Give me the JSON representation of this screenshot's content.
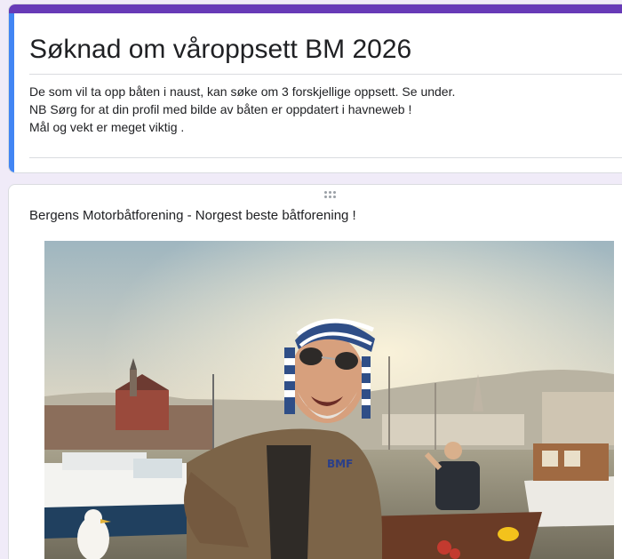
{
  "form": {
    "title": "Søknad om våroppsett BM 2026",
    "description_lines": [
      "De som vil ta opp båten i naust, kan søke om 3 forskjellige oppsett. Se under.",
      "NB Sørg for at din profil med bilde av båten er oppdatert i havneweb !",
      "Mål og vekt er meget viktig ."
    ]
  },
  "item": {
    "title": "Bergens Motorbåtforening - Norgest beste båtforening !",
    "image_text": "BMF"
  },
  "colors": {
    "header_bar": "#673ab7",
    "left_accent": "#4285f4",
    "background": "#f0ebf8"
  },
  "icons": {
    "drag_handle": "drag-handle-icon"
  }
}
